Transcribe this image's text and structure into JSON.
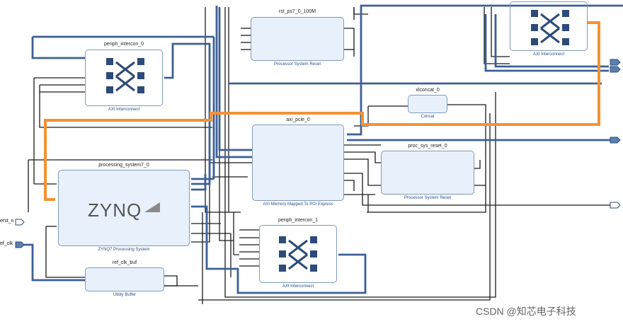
{
  "blocks": {
    "rst_ps7": {
      "name": "rst_ps7_0_100M",
      "desc": "Processor System Reset"
    },
    "periph_intercon_0": {
      "name": "periph_intercon_0",
      "desc": "AXI Interconnect"
    },
    "axi_interconnect_top": {
      "name": "",
      "desc": "AXI Interconnect"
    },
    "xlconcat": {
      "name": "xlconcat_0",
      "desc": "Concat"
    },
    "axi_pcie": {
      "name": "axi_pcie_0",
      "desc": "AXI Memory Mapped To PCI Express"
    },
    "proc_sys_reset": {
      "name": "proc_sys_reset_0",
      "desc": "Processor System Reset"
    },
    "processing_system": {
      "name": "processing_system7_0",
      "desc": "ZYNQ7 Processing System",
      "logo": "ZYNQ"
    },
    "periph_intercon_1": {
      "name": "periph_intercon_1",
      "desc": "AXI Interconnect"
    },
    "ref_clk_buf": {
      "name": "ref_clk_buf",
      "desc": "Utility Buffer"
    }
  },
  "ports": {
    "rst_n": "erst_n",
    "ref_clk": "ef_clk"
  },
  "watermark": "CSDN @知芯电子科技",
  "colors": {
    "axi_bus": "#3d5f96",
    "wire": "#1a1a1a",
    "highlight": "#f39233",
    "block_fill": "#e8f1fb",
    "block_border": "#7f9bb8",
    "port_fill": "#5b7fb1"
  }
}
